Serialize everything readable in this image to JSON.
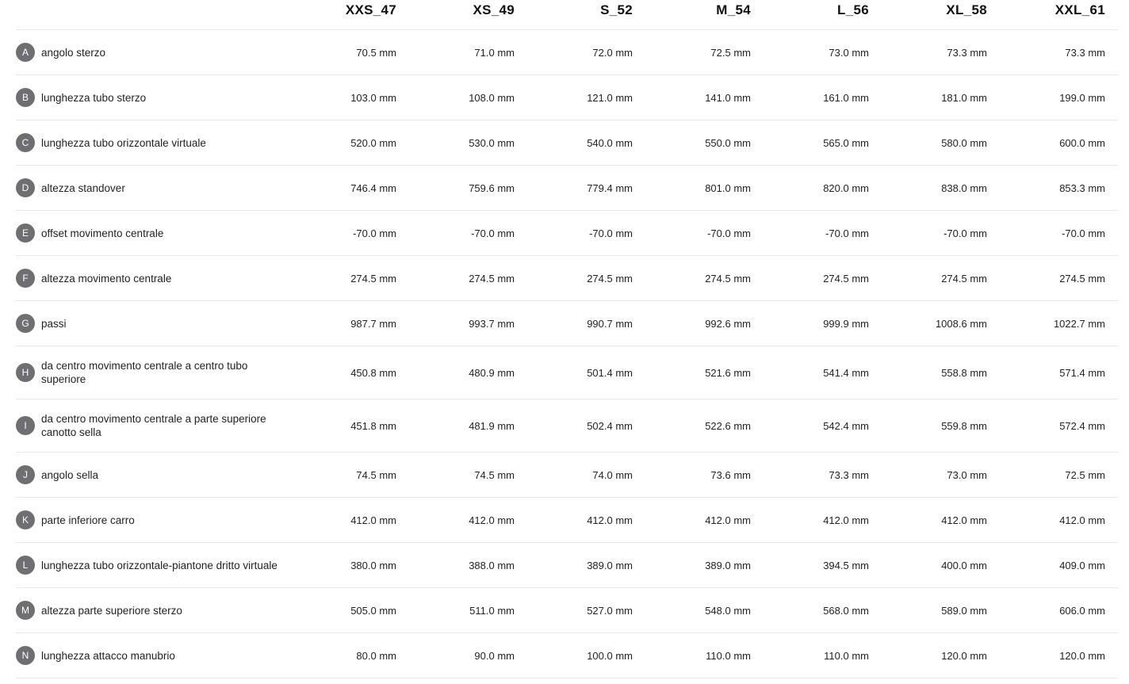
{
  "sizes": [
    "XXS_47",
    "XS_49",
    "S_52",
    "M_54",
    "L_56",
    "XL_58",
    "XXL_61"
  ],
  "rows": [
    {
      "letter": "A",
      "label": "angolo sterzo",
      "values": [
        "70.5 mm",
        "71.0 mm",
        "72.0 mm",
        "72.5 mm",
        "73.0 mm",
        "73.3 mm",
        "73.3 mm"
      ]
    },
    {
      "letter": "B",
      "label": "lunghezza tubo sterzo",
      "values": [
        "103.0 mm",
        "108.0 mm",
        "121.0 mm",
        "141.0 mm",
        "161.0 mm",
        "181.0 mm",
        "199.0 mm"
      ]
    },
    {
      "letter": "C",
      "label": "lunghezza tubo orizzontale virtuale",
      "values": [
        "520.0 mm",
        "530.0 mm",
        "540.0 mm",
        "550.0 mm",
        "565.0 mm",
        "580.0 mm",
        "600.0 mm"
      ]
    },
    {
      "letter": "D",
      "label": "altezza standover",
      "values": [
        "746.4 mm",
        "759.6 mm",
        "779.4 mm",
        "801.0 mm",
        "820.0 mm",
        "838.0 mm",
        "853.3 mm"
      ]
    },
    {
      "letter": "E",
      "label": "offset movimento centrale",
      "values": [
        "-70.0 mm",
        "-70.0 mm",
        "-70.0 mm",
        "-70.0 mm",
        "-70.0 mm",
        "-70.0 mm",
        "-70.0 mm"
      ]
    },
    {
      "letter": "F",
      "label": "altezza movimento centrale",
      "values": [
        "274.5 mm",
        "274.5 mm",
        "274.5 mm",
        "274.5 mm",
        "274.5 mm",
        "274.5 mm",
        "274.5 mm"
      ]
    },
    {
      "letter": "G",
      "label": "passi",
      "values": [
        "987.7 mm",
        "993.7 mm",
        "990.7 mm",
        "992.6 mm",
        "999.9 mm",
        "1008.6 mm",
        "1022.7 mm"
      ]
    },
    {
      "letter": "H",
      "label": "da centro movimento centrale a centro tubo superiore",
      "values": [
        "450.8 mm",
        "480.9 mm",
        "501.4 mm",
        "521.6 mm",
        "541.4 mm",
        "558.8 mm",
        "571.4 mm"
      ]
    },
    {
      "letter": "I",
      "label": "da centro movimento centrale a parte superiore canotto sella",
      "values": [
        "451.8 mm",
        "481.9 mm",
        "502.4 mm",
        "522.6 mm",
        "542.4 mm",
        "559.8 mm",
        "572.4 mm"
      ]
    },
    {
      "letter": "J",
      "label": "angolo sella",
      "values": [
        "74.5 mm",
        "74.5 mm",
        "74.0 mm",
        "73.6 mm",
        "73.3 mm",
        "73.0 mm",
        "72.5 mm"
      ]
    },
    {
      "letter": "K",
      "label": "parte inferiore carro",
      "values": [
        "412.0 mm",
        "412.0 mm",
        "412.0 mm",
        "412.0 mm",
        "412.0 mm",
        "412.0 mm",
        "412.0 mm"
      ]
    },
    {
      "letter": "L",
      "label": "lunghezza tubo orizzontale-piantone dritto virtuale",
      "values": [
        "380.0 mm",
        "388.0 mm",
        "389.0 mm",
        "389.0 mm",
        "394.5 mm",
        "400.0 mm",
        "409.0 mm"
      ]
    },
    {
      "letter": "M",
      "label": "altezza parte superiore sterzo",
      "values": [
        "505.0 mm",
        "511.0 mm",
        "527.0 mm",
        "548.0 mm",
        "568.0 mm",
        "589.0 mm",
        "606.0 mm"
      ]
    },
    {
      "letter": "N",
      "label": "lunghezza attacco manubrio",
      "values": [
        "80.0 mm",
        "90.0 mm",
        "100.0 mm",
        "110.0 mm",
        "110.0 mm",
        "120.0 mm",
        "120.0 mm"
      ]
    }
  ],
  "colors": {
    "badge": "#6e6e73",
    "divider": "#e6e6e6",
    "text": "#222222"
  }
}
